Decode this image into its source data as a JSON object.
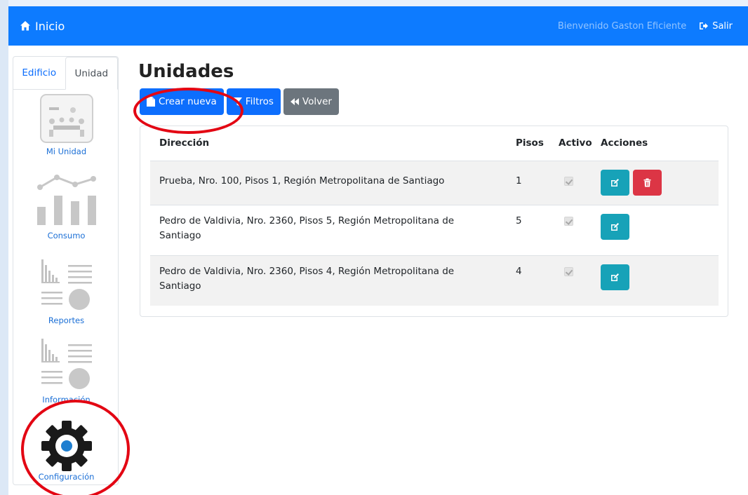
{
  "navbar": {
    "brand": "Inicio",
    "welcome": "Bienvenido Gaston Eficiente",
    "logout": "Salir",
    "color": "#0d7bff"
  },
  "sidebar": {
    "tabs": [
      {
        "label": "Edificio",
        "active": false
      },
      {
        "label": "Unidad",
        "active": true
      }
    ],
    "items": [
      {
        "label": "Mi Unidad",
        "icon": "meeting-room-icon"
      },
      {
        "label": "Consumo",
        "icon": "consumption-chart-icon"
      },
      {
        "label": "Reportes",
        "icon": "reports-icon"
      },
      {
        "label": "Información",
        "icon": "information-icon"
      },
      {
        "label": "Configuración",
        "icon": "gear-icon"
      }
    ]
  },
  "main": {
    "title": "Unidades",
    "buttons": {
      "create": "Crear nueva",
      "filters": "Filtros",
      "back": "Volver"
    },
    "table": {
      "headers": [
        "Dirección",
        "Pisos",
        "Activo",
        "Acciones"
      ],
      "rows": [
        {
          "address": "Prueba, Nro. 100, Pisos 1, Región Metropolitana de Santiago",
          "floors": "1",
          "active": true,
          "can_delete": true
        },
        {
          "address": "Pedro de Valdivia, Nro. 2360, Pisos 5, Región Metropolitana de Santiago",
          "floors": "5",
          "active": true,
          "can_delete": false
        },
        {
          "address": "Pedro de Valdivia, Nro. 2360, Pisos 4, Región Metropolitana de Santiago",
          "floors": "4",
          "active": true,
          "can_delete": false
        }
      ]
    }
  },
  "colors": {
    "primary": "#0d6efd",
    "secondary": "#6c757d",
    "info": "#17a2b8",
    "danger": "#dc3545",
    "annotation": "#e30613"
  }
}
